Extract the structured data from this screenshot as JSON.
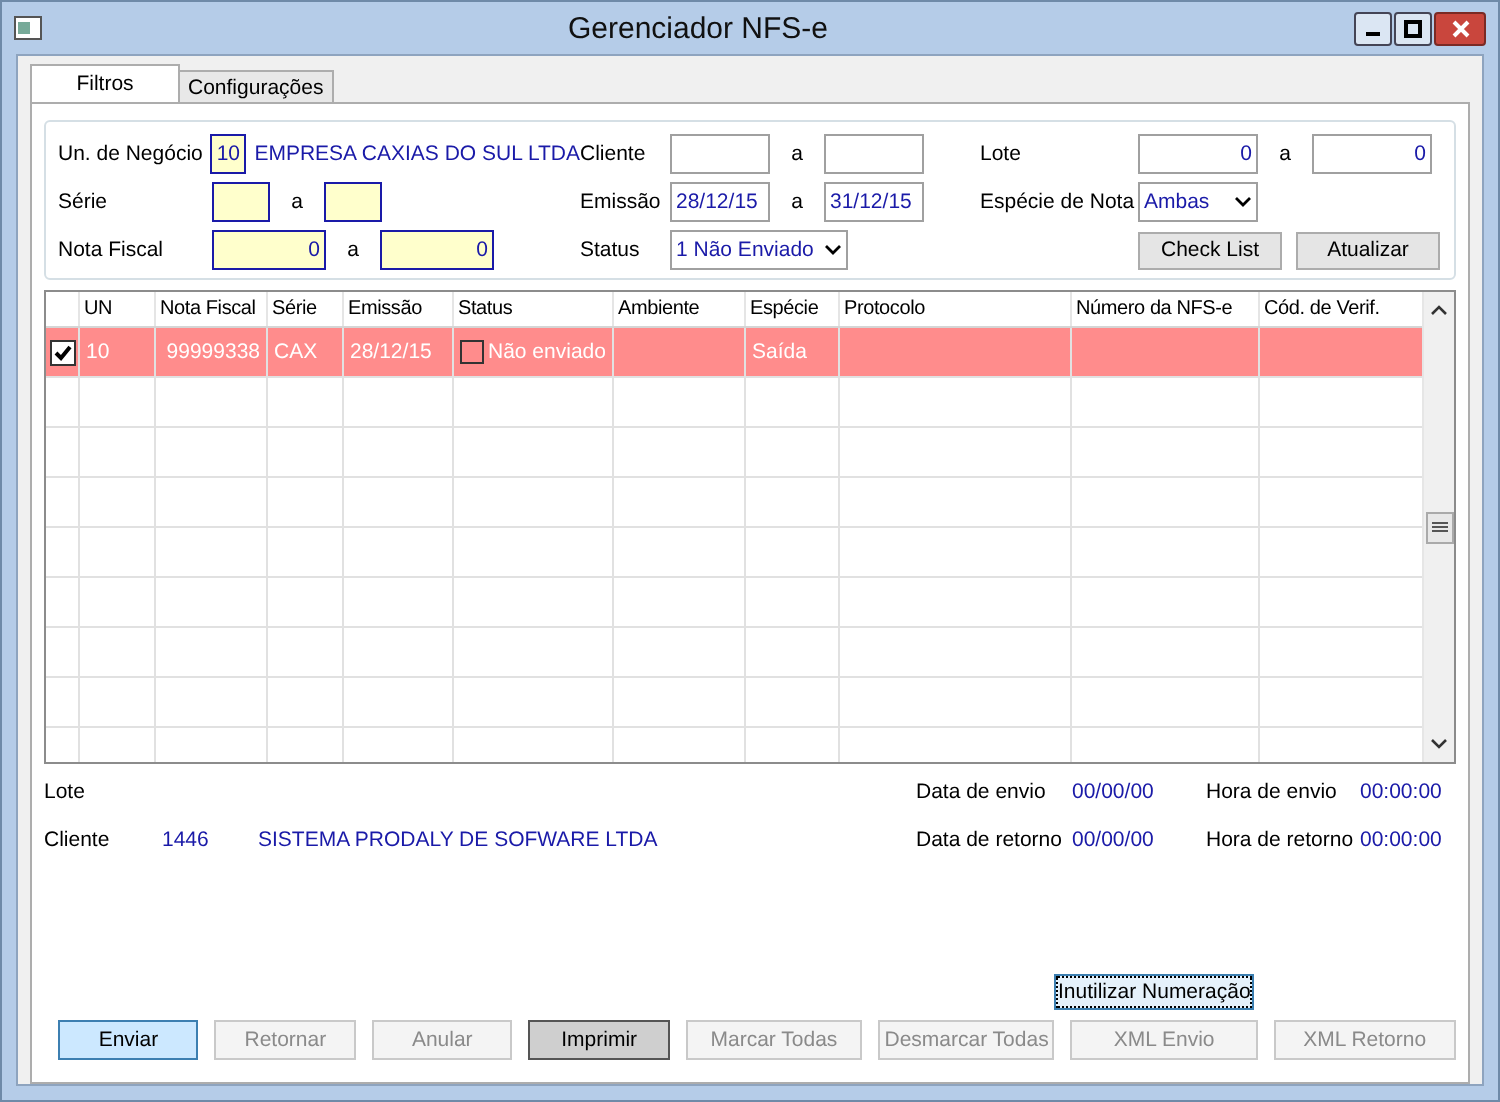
{
  "window": {
    "title": "Gerenciador NFS-e"
  },
  "tabs": [
    {
      "label": "Filtros",
      "selected": true
    },
    {
      "label": "Configurações",
      "selected": false
    }
  ],
  "filters": {
    "unidade": {
      "label": "Un. de Negócio",
      "code": "10",
      "name": "EMPRESA CAXIAS DO SUL LTDA"
    },
    "serie": {
      "label": "Série",
      "sep": "a"
    },
    "nota_fiscal": {
      "label": "Nota Fiscal",
      "from": "0",
      "to": "0",
      "sep": "a"
    },
    "cliente": {
      "label": "Cliente",
      "sep": "a"
    },
    "emissao": {
      "label": "Emissão",
      "from": "28/12/15",
      "to": "31/12/15",
      "sep": "a"
    },
    "status": {
      "label": "Status",
      "value": "1 Não Enviado"
    },
    "lote": {
      "label": "Lote",
      "from": "0",
      "to": "0",
      "sep": "a"
    },
    "especie": {
      "label": "Espécie de Nota",
      "value": "Ambas"
    },
    "buttons": [
      {
        "label": "Check List"
      },
      {
        "label": "Atualizar"
      }
    ]
  },
  "grid": {
    "columns": [
      "UN",
      "Nota Fiscal",
      "Série",
      "Emissão",
      "Status",
      "Ambiente",
      "Espécie",
      "Protocolo",
      "Número da NFS-e",
      "Cód. de Verif."
    ],
    "rows": [
      {
        "checked": true,
        "selected": true,
        "status_flag": false,
        "cells": [
          "10",
          "99999338",
          "CAX",
          "28/12/15",
          "Não enviado",
          "",
          "Saída",
          "",
          "",
          ""
        ]
      }
    ]
  },
  "info": {
    "lote_label": "Lote",
    "cliente_label": "Cliente",
    "cliente_code": "1446",
    "cliente_name": "SISTEMA PRODALY DE SOFWARE LTDA",
    "data_envio_label": "Data de envio",
    "data_envio": "00/00/00",
    "hora_envio_label": "Hora de envio",
    "hora_envio": "00:00:00",
    "data_retorno_label": "Data de retorno",
    "data_retorno": "00/00/00",
    "hora_retorno_label": "Hora de retorno",
    "hora_retorno": "00:00:00"
  },
  "inutilizar_button": {
    "label": "Inutilizar Numeração",
    "focused": true
  },
  "buttons": [
    {
      "label": "Enviar",
      "kind": "default",
      "disabled": false
    },
    {
      "label": "Retornar",
      "kind": "normal",
      "disabled": true
    },
    {
      "label": "Anular",
      "kind": "normal",
      "disabled": true
    },
    {
      "label": "Imprimir",
      "kind": "pressed",
      "disabled": false
    },
    {
      "label": "Marcar Todas",
      "kind": "normal",
      "disabled": true
    },
    {
      "label": "Desmarcar Todas",
      "kind": "normal",
      "disabled": true
    },
    {
      "label": "XML Envio",
      "kind": "normal",
      "disabled": true
    },
    {
      "label": "XML Retorno",
      "kind": "normal",
      "disabled": true
    }
  ]
}
